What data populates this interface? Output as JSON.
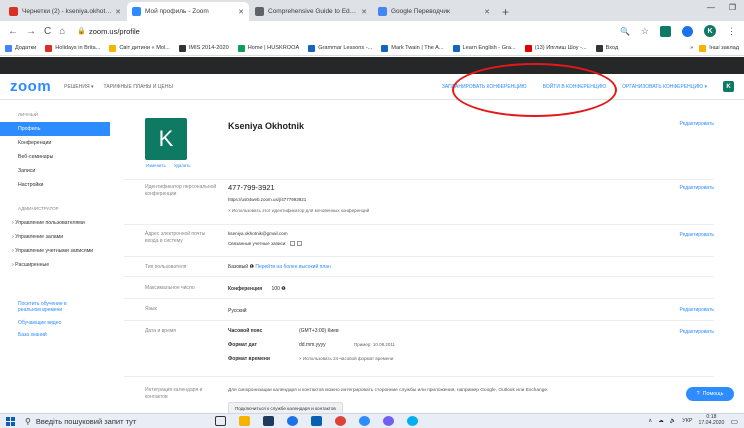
{
  "browser": {
    "tabs": [
      {
        "title": "Чернетки (2) - kseniya.okhotnik",
        "color": "#d93025",
        "active": false
      },
      {
        "title": "Мой профиль - Zoom",
        "color": "#2d8cff",
        "active": true
      },
      {
        "title": "Comprehensive Guide to Educa",
        "color": "#5f6368",
        "active": false
      },
      {
        "title": "Google Переводчик",
        "color": "#4285f4",
        "active": false
      }
    ],
    "url": "zoom.us/profile",
    "bookmarks": [
      {
        "label": "Додатки",
        "color": "#4285f4"
      },
      {
        "label": "Holidays in Brita...",
        "color": "#d93025"
      },
      {
        "label": "Світ дитини « Mol...",
        "color": "#f4b400"
      },
      {
        "label": "IMIS 2014-2020",
        "color": "#333333"
      },
      {
        "label": "Home | HUSKROOA",
        "color": "#0f9d58"
      },
      {
        "label": "Grammar Lessons -...",
        "color": "#1565c0"
      },
      {
        "label": "Mark Twain | The A...",
        "color": "#1565c0"
      },
      {
        "label": "Learn English - Gra...",
        "color": "#1565c0"
      },
      {
        "label": "(13) Ипглиш Шоу -...",
        "color": "#e00000"
      },
      {
        "label": "Вход",
        "color": "#333333"
      }
    ],
    "bookmarks_right": "Інші заклад"
  },
  "zoom": {
    "logo": "zoom",
    "nav": [
      "РЕШЕНИЯ ▾",
      "ТАРИФНЫЕ ПЛАНЫ И ЦЕНЫ"
    ],
    "right_links": [
      "ЗАПЛАНИРОВАТЬ КОНФЕРЕНЦИЮ",
      "ВОЙТИ В КОНФЕРЕНЦИЮ",
      "ОРГАНИЗОВАТЬ КОНФЕРЕНЦИЮ ▾"
    ],
    "avatar_letter": "K"
  },
  "sidebar": {
    "personal_header": "ЛИЧНЫЙ",
    "items": [
      "Профиль",
      "Конференции",
      "Веб-семинары",
      "Записи",
      "Настройки"
    ],
    "admin_header": "АДМИНИСТРАТОР",
    "admin_items": [
      "Управление пользователями",
      "Управление залами",
      "Управление учетными записями",
      "Расширенные"
    ],
    "links": [
      "Посетить обучение в реальном времени",
      "Обучающие видео",
      "База знаний"
    ]
  },
  "profile": {
    "avatar_letter": "K",
    "change_link": "Изменить",
    "delete_link": "Удалить",
    "name": "Kseniya Okhotnik",
    "edit": "Редактировать",
    "pmi_label": "Идентификатор персональной конференции",
    "pmi_value": "477-799-3921",
    "pmi_url": "https://us04web.zoom.us/j/4777993921",
    "pmi_note": "× Использовать этот идентификатор для мгновенных конференций",
    "email_label": "Адрес электронной почты входа в систему",
    "email_value": "kseniya.okhotnik@gmail.com",
    "linked_accounts": "Связанные учетные записи:",
    "user_type_label": "Тип пользователя",
    "user_type_value": "Базовый",
    "upgrade_link": "Перейти на более высокий план",
    "capacity_label": "Максимальное число",
    "capacity_key": "Конференция",
    "capacity_value": "100",
    "language_label": "Язык",
    "language_value": "Русский",
    "datetime_label": "Дата и время",
    "timezone_key": "Часовой пояс",
    "timezone_value": "(GMT+3:00) Киев",
    "date_format_key": "Формат дат",
    "date_format_value": "dd.mm.yyyy",
    "date_example": "Пример: 10.08.2011",
    "time_format_key": "Формат времени",
    "time_format_value": "× Использовать 24-часовой формат времени",
    "calendar_label": "Интеграция календаря и контактов",
    "calendar_text": "Для синхронизации календаря и контактов можно интегрировать сторонние службы или приложения, например Google, Outlook или Exchange.",
    "calendar_button": "Подключиться к службе календаря и контактов"
  },
  "help_button": "Помощь",
  "taskbar": {
    "search_placeholder": "Введіть пошуковий запит тут",
    "lang": "УКР",
    "time": "0:18",
    "date": "17.04.2020"
  }
}
